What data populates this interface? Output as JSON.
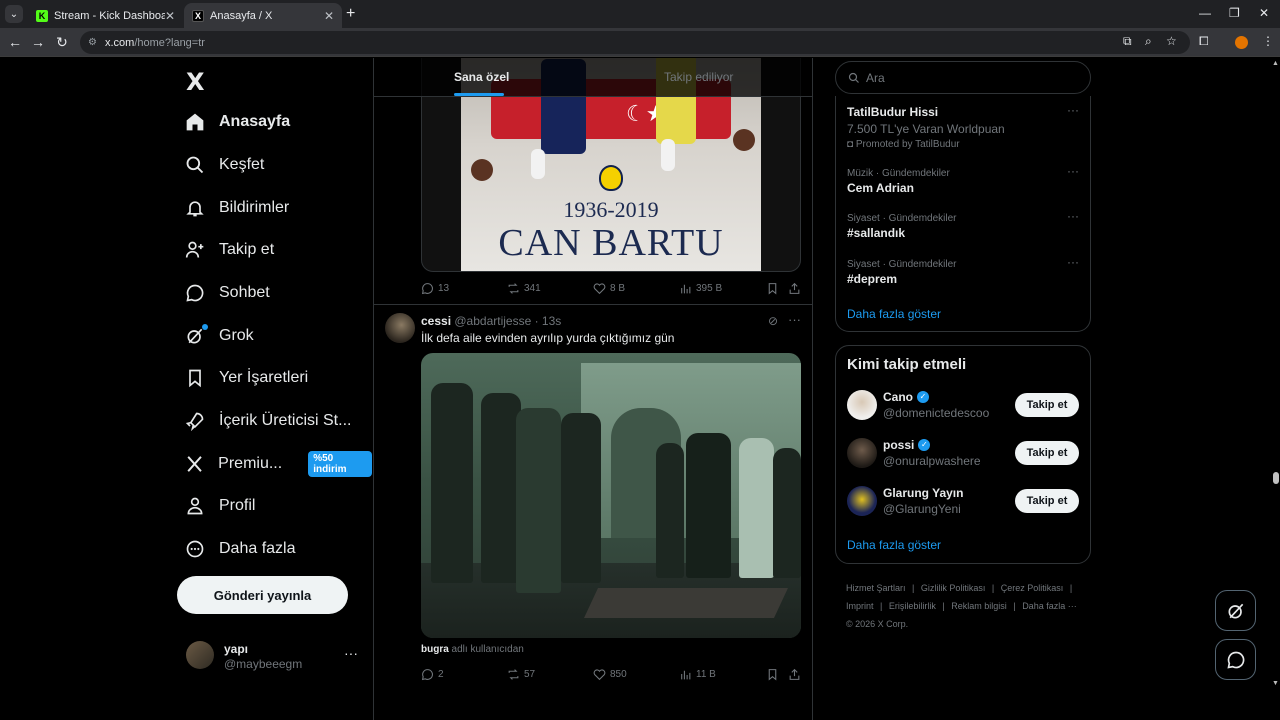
{
  "browser": {
    "tabs": [
      {
        "title": "Stream - Kick Dashboard",
        "favicon": "kick-icon"
      },
      {
        "title": "Anasayfa / X",
        "favicon": "x-icon"
      }
    ],
    "url_host": "x.com",
    "url_path": "/home?lang=tr"
  },
  "sidebar": {
    "logo": "X",
    "items": [
      {
        "label": "Anasayfa",
        "icon": "home-icon"
      },
      {
        "label": "Keşfet",
        "icon": "search-icon"
      },
      {
        "label": "Bildirimler",
        "icon": "bell-icon"
      },
      {
        "label": "Takip et",
        "icon": "add-person-icon"
      },
      {
        "label": "Sohbet",
        "icon": "chat-icon"
      },
      {
        "label": "Grok",
        "icon": "grok-icon"
      },
      {
        "label": "Yer İşaretleri",
        "icon": "bookmark-icon"
      },
      {
        "label": "İçerik Üreticisi St...",
        "icon": "rocket-icon"
      },
      {
        "label": "Premiu...",
        "icon": "x-icon",
        "badge": "%50 indirim"
      },
      {
        "label": "Profil",
        "icon": "person-icon"
      },
      {
        "label": "Daha fazla",
        "icon": "more-circle-icon"
      }
    ],
    "post_button": "Gönderi yayınla",
    "account": {
      "name": "yapı",
      "handle": "@maybeeegm",
      "more": "···"
    }
  },
  "feed": {
    "tabs": {
      "for_you": "Sana özel",
      "following": "Takip ediliyor"
    },
    "tweet1": {
      "poster_years": "1936-2019",
      "poster_name": "CAN BARTU",
      "stats": {
        "replies": "13",
        "reposts": "341",
        "likes": "8 B",
        "views": "395 B"
      }
    },
    "tweet2": {
      "name": "cessi",
      "handle": "@abdartijesse",
      "time": " · 13s",
      "text": "İlk defa aile evinden ayrılıp yurda çıktığımız gün",
      "caption_user": "bugra",
      "caption_rest": " adlı kullanıcıdan",
      "stats": {
        "replies": "2",
        "reposts": "57",
        "likes": "850",
        "views": "11 B"
      }
    }
  },
  "right": {
    "search_placeholder": "Ara",
    "trends": [
      {
        "name": "TatilBudur Hissi",
        "sub": "7.500 TL'ye Varan Worldpuan",
        "promo": "Promoted by TatilBudur"
      },
      {
        "meta": "Müzik · Gündemdekiler",
        "name": "Cem Adrian"
      },
      {
        "meta": "Siyaset · Gündemdekiler",
        "name": "#sallandık"
      },
      {
        "meta": "Siyaset · Gündemdekiler",
        "name": "#deprem"
      }
    ],
    "show_more": "Daha fazla göster",
    "who_to_follow": {
      "title": "Kimi takip etmeli",
      "users": [
        {
          "name": "Cano",
          "handle": "@domenictedescoo",
          "verified": true,
          "button": "Takip et"
        },
        {
          "name": "possi",
          "handle": "@onuralpwashere",
          "verified": true,
          "button": "Takip et"
        },
        {
          "name": "Glarung Yayın",
          "handle": "@GlarungYeni",
          "verified": false,
          "button": "Takip et"
        }
      ],
      "show_more": "Daha fazla göster"
    },
    "footer": {
      "links": [
        "Hizmet Şartları",
        "|",
        "Gizlilik Politikası",
        "|",
        "Çerez Politikası",
        "|",
        "Imprint",
        "|",
        "Erişilebilirlik",
        "|",
        "Reklam bilgisi",
        "|",
        "Daha fazla ···"
      ],
      "copyright": "© 2026 X Corp."
    }
  },
  "colors": {
    "accent": "#1d9bf0",
    "background": "#000000",
    "border": "#2f3336",
    "muted": "#71767b"
  }
}
